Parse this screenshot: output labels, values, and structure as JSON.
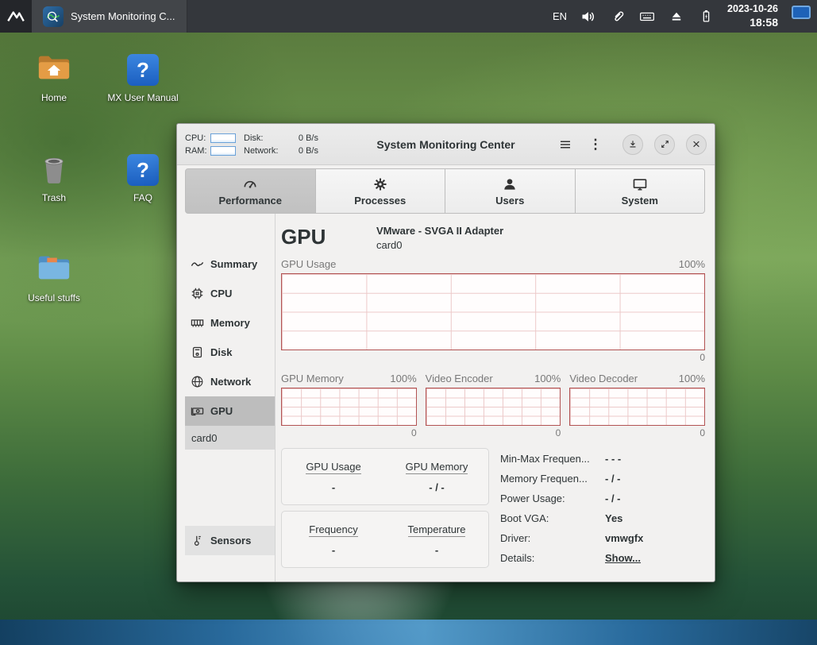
{
  "taskbar": {
    "app_title": "System Monitoring C...",
    "language": "EN",
    "date": "2023-10-26",
    "time": "18:58"
  },
  "desktop": {
    "icons": [
      {
        "label": "Home"
      },
      {
        "label": "MX User Manual"
      },
      {
        "label": "Trash"
      },
      {
        "label": "FAQ"
      },
      {
        "label": "Useful stuffs"
      }
    ],
    "help_glyph": "?"
  },
  "window": {
    "headerbar": {
      "title": "System Monitoring Center",
      "cpu_label": "CPU:",
      "ram_label": "RAM:",
      "disk_label": "Disk:",
      "disk_value": "0 B/s",
      "network_label": "Network:",
      "network_value": "0 B/s",
      "kebab_glyph": "⋮",
      "close_glyph": "×"
    },
    "tabs": [
      {
        "label": "Performance",
        "selected": true
      },
      {
        "label": "Processes",
        "selected": false
      },
      {
        "label": "Users",
        "selected": false
      },
      {
        "label": "System",
        "selected": false
      }
    ],
    "sidebar": {
      "items": [
        {
          "label": "Summary",
          "selected": false
        },
        {
          "label": "CPU",
          "selected": false
        },
        {
          "label": "Memory",
          "selected": false
        },
        {
          "label": "Disk",
          "selected": false
        },
        {
          "label": "Network",
          "selected": false
        },
        {
          "label": "GPU",
          "selected": true
        }
      ],
      "device": "card0",
      "sensors": "Sensors"
    },
    "gpu_page": {
      "heading": "GPU",
      "adapter": "VMware - SVGA II Adapter",
      "device": "card0",
      "usage_chart": {
        "title": "GPU Usage",
        "max_label": "100%",
        "min_label": "0"
      },
      "charts": [
        {
          "title": "GPU Memory",
          "max_label": "100%",
          "min_label": "0"
        },
        {
          "title": "Video Encoder",
          "max_label": "100%",
          "min_label": "0"
        },
        {
          "title": "Video Decoder",
          "max_label": "100%",
          "min_label": "0"
        }
      ],
      "stat_boxes": [
        {
          "cells": [
            {
              "label": "GPU Usage",
              "value": "-"
            },
            {
              "label": "GPU Memory",
              "value": "- / -"
            }
          ]
        },
        {
          "cells": [
            {
              "label": "Frequency",
              "value": "-"
            },
            {
              "label": "Temperature",
              "value": "-"
            }
          ]
        }
      ],
      "details": [
        {
          "label": "Min-Max Frequen...",
          "value": "- - -"
        },
        {
          "label": "Memory Frequen...",
          "value": "- / -"
        },
        {
          "label": "Power Usage:",
          "value": "- / -"
        },
        {
          "label": "Boot VGA:",
          "value": "Yes"
        },
        {
          "label": "Driver:",
          "value": "vmwgfx"
        },
        {
          "label": "Details:",
          "value": "Show..."
        }
      ]
    }
  },
  "colors": {
    "taskbar_bg": "#34373c",
    "selection_gray": "#bdbdbd",
    "chart_border": "#b25353",
    "chart_grid": "#ecc9c9",
    "help_blue": "#1b5fc0",
    "tray_display_blue": "#1e62b8"
  }
}
